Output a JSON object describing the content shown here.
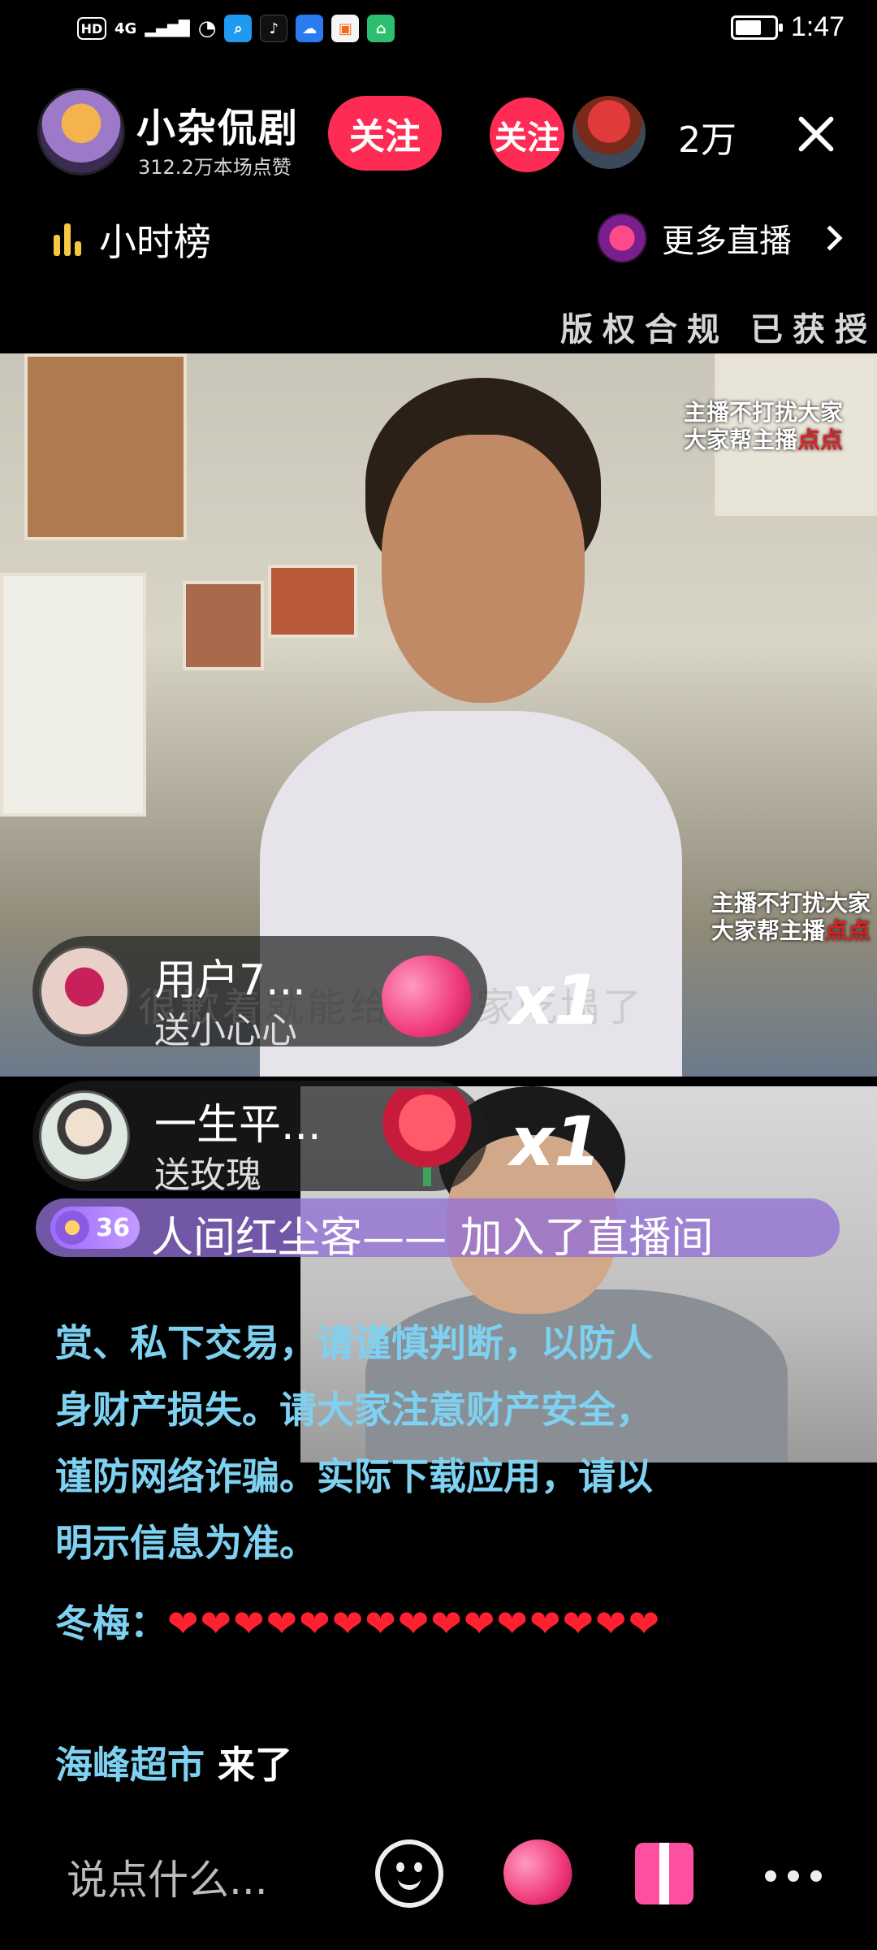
{
  "status_bar": {
    "time": "1:47",
    "hd": "HD",
    "network": "4G"
  },
  "header": {
    "host_name": "小杂侃剧",
    "host_likes": "312.2万本场点赞",
    "follow_label": "关注",
    "follow_small_label": "关注",
    "viewer_count": "2万"
  },
  "rank": {
    "label": "小时榜"
  },
  "more_live": {
    "label": "更多直播"
  },
  "copyright": "版权合规 已获授",
  "video": {
    "overlay_top": [
      "主播不打扰大家",
      "大家帮主播"
    ],
    "overlay_top_red": "点点",
    "overlay_bottom": [
      "主播不打扰大家",
      "大家帮主播"
    ],
    "overlay_bottom_red": "点点",
    "subtitle": "很歉着就能给一个家吃塌了"
  },
  "gifts": [
    {
      "user": "用户7...",
      "action": "送小心心",
      "count": "x1"
    },
    {
      "user": "一生平...",
      "action": "送玫瑰",
      "count": "x1"
    }
  ],
  "join_notice": {
    "level": "36",
    "text": "人间红尘客—— 加入了直播间"
  },
  "chat": {
    "notice": "赏、私下交易，请谨慎判断，以防人身财产损失。请大家注意财产安全，谨防网络诈骗。实际下载应用，请以明示信息为准。",
    "messages": [
      {
        "user": "冬梅：",
        "text": "❤❤❤❤❤❤❤❤❤❤❤❤❤❤❤"
      },
      {
        "user": "海峰超市",
        "text": "来了"
      }
    ]
  },
  "bottom": {
    "placeholder": "说点什么..."
  },
  "colors": {
    "accent": "#fe2c55",
    "chat_name": "#7ed1f0",
    "join_bg": "#9470d6"
  }
}
